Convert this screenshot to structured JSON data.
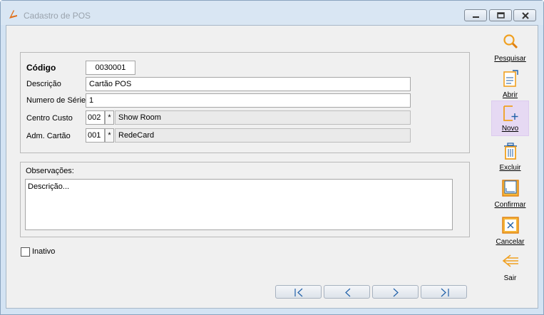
{
  "window": {
    "title": "Cadastro de POS",
    "accent_color": "#e0701a"
  },
  "form": {
    "codigo": {
      "label": "Código",
      "value": "0030001"
    },
    "descricao": {
      "label": "Descrição",
      "value": "Cartão POS"
    },
    "numero_serie": {
      "label": "Numero de Série",
      "value": "1"
    },
    "centro_custo": {
      "label": "Centro Custo",
      "code": "002",
      "lookup": "*",
      "name": "Show Room"
    },
    "adm_cartao": {
      "label": "Adm. Cartão",
      "code": "001",
      "lookup": "*",
      "name": "RedeCard"
    }
  },
  "observacoes": {
    "label": "Observações:",
    "value": "Descrição..."
  },
  "inativo": {
    "label": "Inativo",
    "checked": false
  },
  "toolbar": {
    "pesquisar": "Pesquisar",
    "abrir": "Abrir",
    "novo": "Novo",
    "excluir": "Excluir",
    "confirmar": "Confirmar",
    "cancelar": "Cancelar",
    "sair": "Sair"
  },
  "navigation": {
    "icons": [
      "first-record-icon",
      "previous-record-icon",
      "next-record-icon",
      "last-record-icon"
    ]
  }
}
